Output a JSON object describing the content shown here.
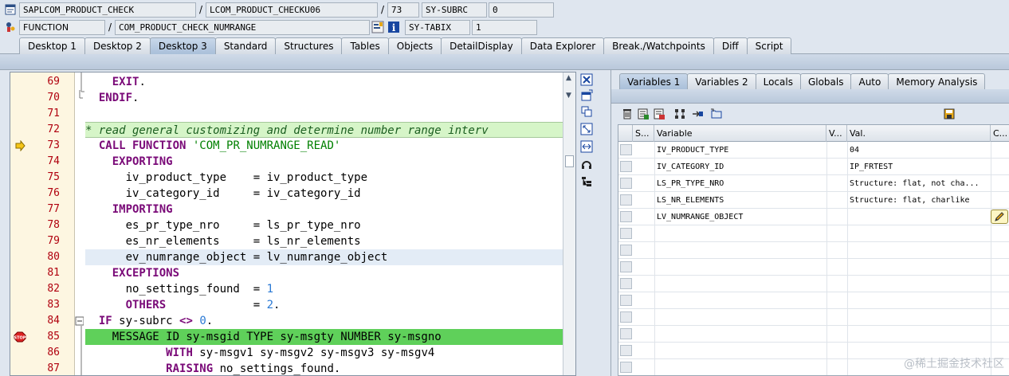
{
  "header": {
    "row1": {
      "program": "SAPLCOM_PRODUCT_CHECK",
      "include": "LCOM_PRODUCT_CHECKU06",
      "line": "73",
      "sysvar_name": "SY-SUBRC",
      "sysvar_value": "0"
    },
    "row2": {
      "type": "FUNCTION",
      "name": "COM_PRODUCT_CHECK_NUMRANGE",
      "sysvar_name": "SY-TABIX",
      "sysvar_value": "1"
    },
    "slash": "/"
  },
  "tabs": [
    "Desktop 1",
    "Desktop 2",
    "Desktop 3",
    "Standard",
    "Structures",
    "Tables",
    "Objects",
    "DetailDisplay",
    "Data Explorer",
    "Break./Watchpoints",
    "Diff",
    "Script"
  ],
  "active_tab": "Desktop 3",
  "code": [
    {
      "n": "69",
      "tokens": [
        [
          "    ",
          ""
        ],
        [
          "EXIT",
          "kw"
        ],
        [
          ".",
          ""
        ]
      ]
    },
    {
      "n": "70",
      "tokens": [
        [
          "  ",
          ""
        ],
        [
          "ENDIF",
          "kw"
        ],
        [
          ".",
          ""
        ]
      ]
    },
    {
      "n": "71",
      "tokens": [
        [
          "",
          ""
        ]
      ]
    },
    {
      "n": "72",
      "style": "comment",
      "tokens": [
        [
          "* read general customizing and determine number range interv",
          ""
        ]
      ]
    },
    {
      "n": "73",
      "tokens": [
        [
          "  ",
          ""
        ],
        [
          "CALL FUNCTION",
          "kw"
        ],
        [
          " ",
          ""
        ],
        [
          "'COM_PR_NUMRANGE_READ'",
          "str"
        ]
      ]
    },
    {
      "n": "74",
      "tokens": [
        [
          "    ",
          ""
        ],
        [
          "EXPORTING",
          "kw"
        ]
      ]
    },
    {
      "n": "75",
      "tokens": [
        [
          "      iv_product_type    = iv_product_type",
          ""
        ]
      ]
    },
    {
      "n": "76",
      "tokens": [
        [
          "      iv_category_id     = iv_category_id",
          ""
        ]
      ]
    },
    {
      "n": "77",
      "tokens": [
        [
          "    ",
          ""
        ],
        [
          "IMPORTING",
          "kw"
        ]
      ]
    },
    {
      "n": "78",
      "tokens": [
        [
          "      es_pr_type_nro     = ls_pr_type_nro",
          ""
        ]
      ]
    },
    {
      "n": "79",
      "tokens": [
        [
          "      es_nr_elements     = ls_nr_elements",
          ""
        ]
      ]
    },
    {
      "n": "80",
      "style": "current",
      "tokens": [
        [
          "      ev_numrange_object = lv_numrange_object",
          ""
        ]
      ]
    },
    {
      "n": "81",
      "tokens": [
        [
          "    ",
          ""
        ],
        [
          "EXCEPTIONS",
          "kw"
        ]
      ]
    },
    {
      "n": "82",
      "tokens": [
        [
          "      no_settings_found  = ",
          ""
        ],
        [
          "1",
          "num"
        ]
      ]
    },
    {
      "n": "83",
      "tokens": [
        [
          "      ",
          ""
        ],
        [
          "OTHERS",
          "kw"
        ],
        [
          "             = ",
          ""
        ],
        [
          "2",
          "num"
        ],
        [
          ".",
          ""
        ]
      ]
    },
    {
      "n": "84",
      "tokens": [
        [
          "  ",
          ""
        ],
        [
          "IF",
          "kw"
        ],
        [
          " sy-subrc ",
          ""
        ],
        [
          "<>",
          "kw"
        ],
        [
          " ",
          ""
        ],
        [
          "0",
          "num"
        ],
        [
          ".",
          ""
        ]
      ]
    },
    {
      "n": "85",
      "style": "green",
      "tokens": [
        [
          "    MESSAGE ID sy-msgid TYPE sy-msgty NUMBER sy-msgno",
          ""
        ]
      ]
    },
    {
      "n": "86",
      "tokens": [
        [
          "            ",
          ""
        ],
        [
          "WITH",
          "kw"
        ],
        [
          " sy-msgv1 sy-msgv2 sy-msgv3 sy-msgv4",
          ""
        ]
      ]
    },
    {
      "n": "87",
      "tokens": [
        [
          "            ",
          ""
        ],
        [
          "RAISING",
          "kw"
        ],
        [
          " no_settings_found.",
          ""
        ]
      ]
    }
  ],
  "right_tabs": [
    "Variables 1",
    "Variables 2",
    "Locals",
    "Globals",
    "Auto",
    "Memory Analysis"
  ],
  "active_right_tab": "Variables 1",
  "var_columns": [
    "S...",
    "Variable",
    "V...",
    "Val.",
    "C..."
  ],
  "variables": [
    {
      "name": "IV_PRODUCT_TYPE",
      "value": "04"
    },
    {
      "name": "IV_CATEGORY_ID",
      "value": "IP_FRTEST"
    },
    {
      "name": "LS_PR_TYPE_NRO",
      "value": "Structure: flat, not cha..."
    },
    {
      "name": "LS_NR_ELEMENTS",
      "value": "Structure: flat, charlike"
    },
    {
      "name": "LV_NUMRANGE_OBJECT",
      "value": ""
    }
  ],
  "watermark": "@稀土掘金技术社区",
  "colors": {
    "accent": "#a9bfd9",
    "line_number": "#b0000e",
    "keyword": "#7a0a78",
    "highlight_green": "#5fd05a"
  }
}
